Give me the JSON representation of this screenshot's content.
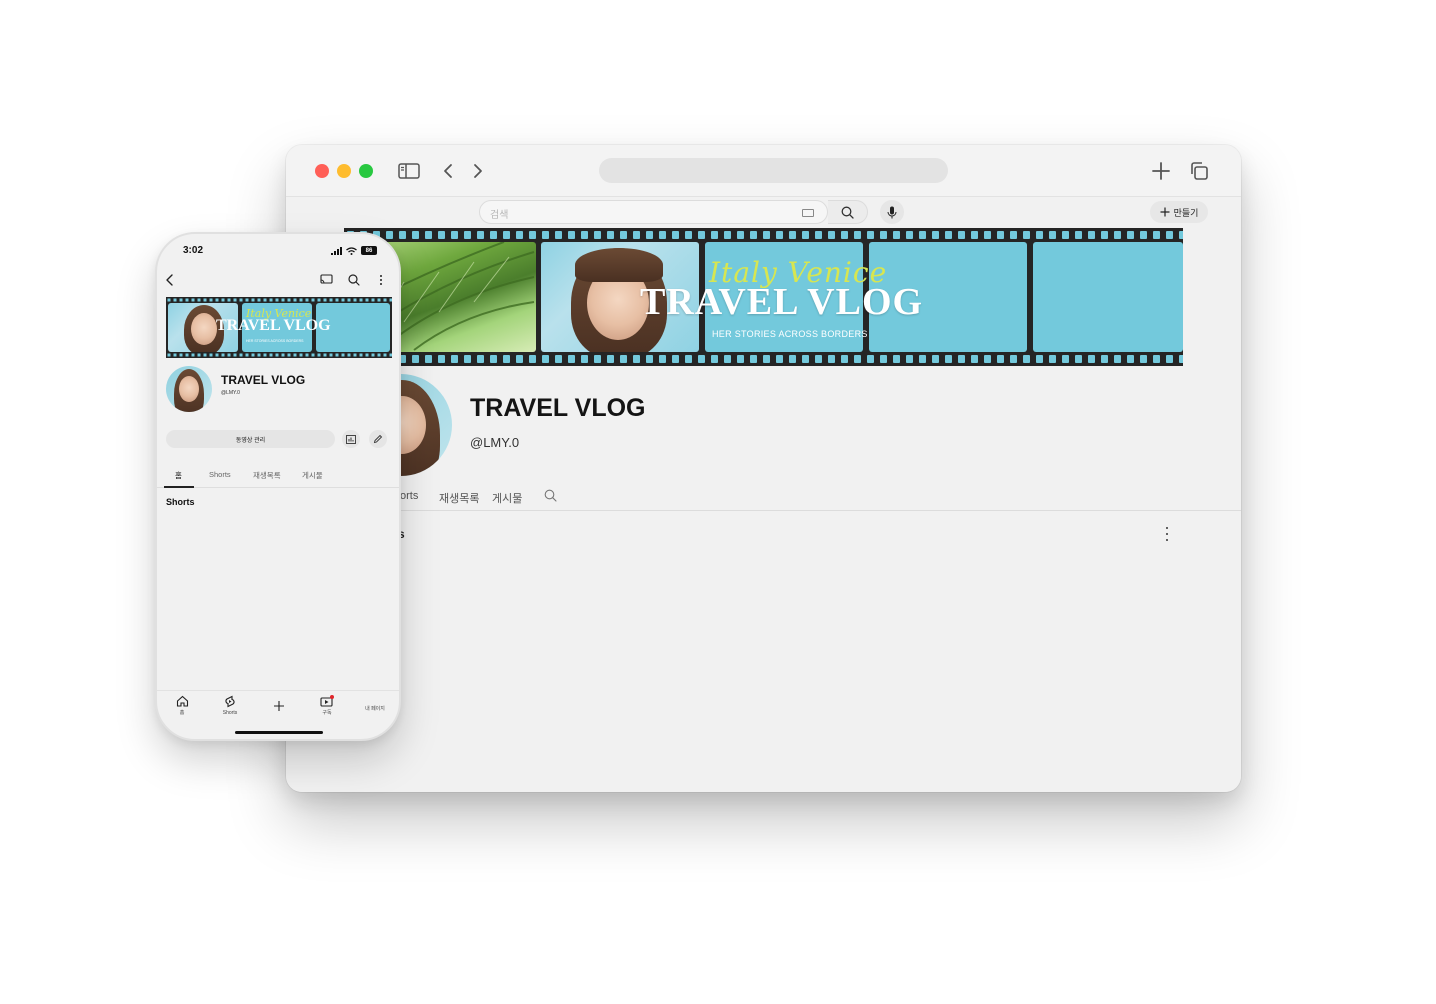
{
  "browser": {
    "search_placeholder": "검색",
    "create_label": "만들기",
    "banner": {
      "script_text": "Italy Venice",
      "title": "TRAVEL VLOG",
      "subtitle": "HER STORIES ACROSS BORDERS"
    },
    "channel": {
      "name": "TRAVEL VLOG",
      "handle": "@LMY.0"
    },
    "tabs": [
      {
        "label": "orts"
      },
      {
        "label": "재생목록"
      },
      {
        "label": "게시물"
      }
    ],
    "section_title": "s"
  },
  "phone": {
    "time": "3:02",
    "battery": "86",
    "banner": {
      "script_text": "Italy Venice",
      "title": "TRAVEL VLOG",
      "subtitle": "HER STORIES ACROSS BORDERS"
    },
    "channel": {
      "name": "TRAVEL VLOG",
      "handle": "@LMY.0"
    },
    "manage_videos_label": "동영상 관리",
    "tabs": [
      {
        "label": "홈"
      },
      {
        "label": "Shorts"
      },
      {
        "label": "재생목록"
      },
      {
        "label": "게시물"
      }
    ],
    "section_title": "Shorts",
    "bottom_nav": [
      {
        "label": "홈",
        "icon": "home-icon"
      },
      {
        "label": "Shorts",
        "icon": "shorts-icon"
      },
      {
        "label": "",
        "icon": "plus-icon"
      },
      {
        "label": "구독",
        "icon": "subscriptions-icon"
      },
      {
        "label": "내 페이지",
        "icon": "profile-icon"
      }
    ]
  },
  "colors": {
    "banner_sky": "#73c9dc",
    "film_strip": "#252525",
    "script_yellow": "#d7e651",
    "mac_red": "#ff5f57",
    "mac_yellow": "#febc2e",
    "mac_green": "#28c840"
  }
}
